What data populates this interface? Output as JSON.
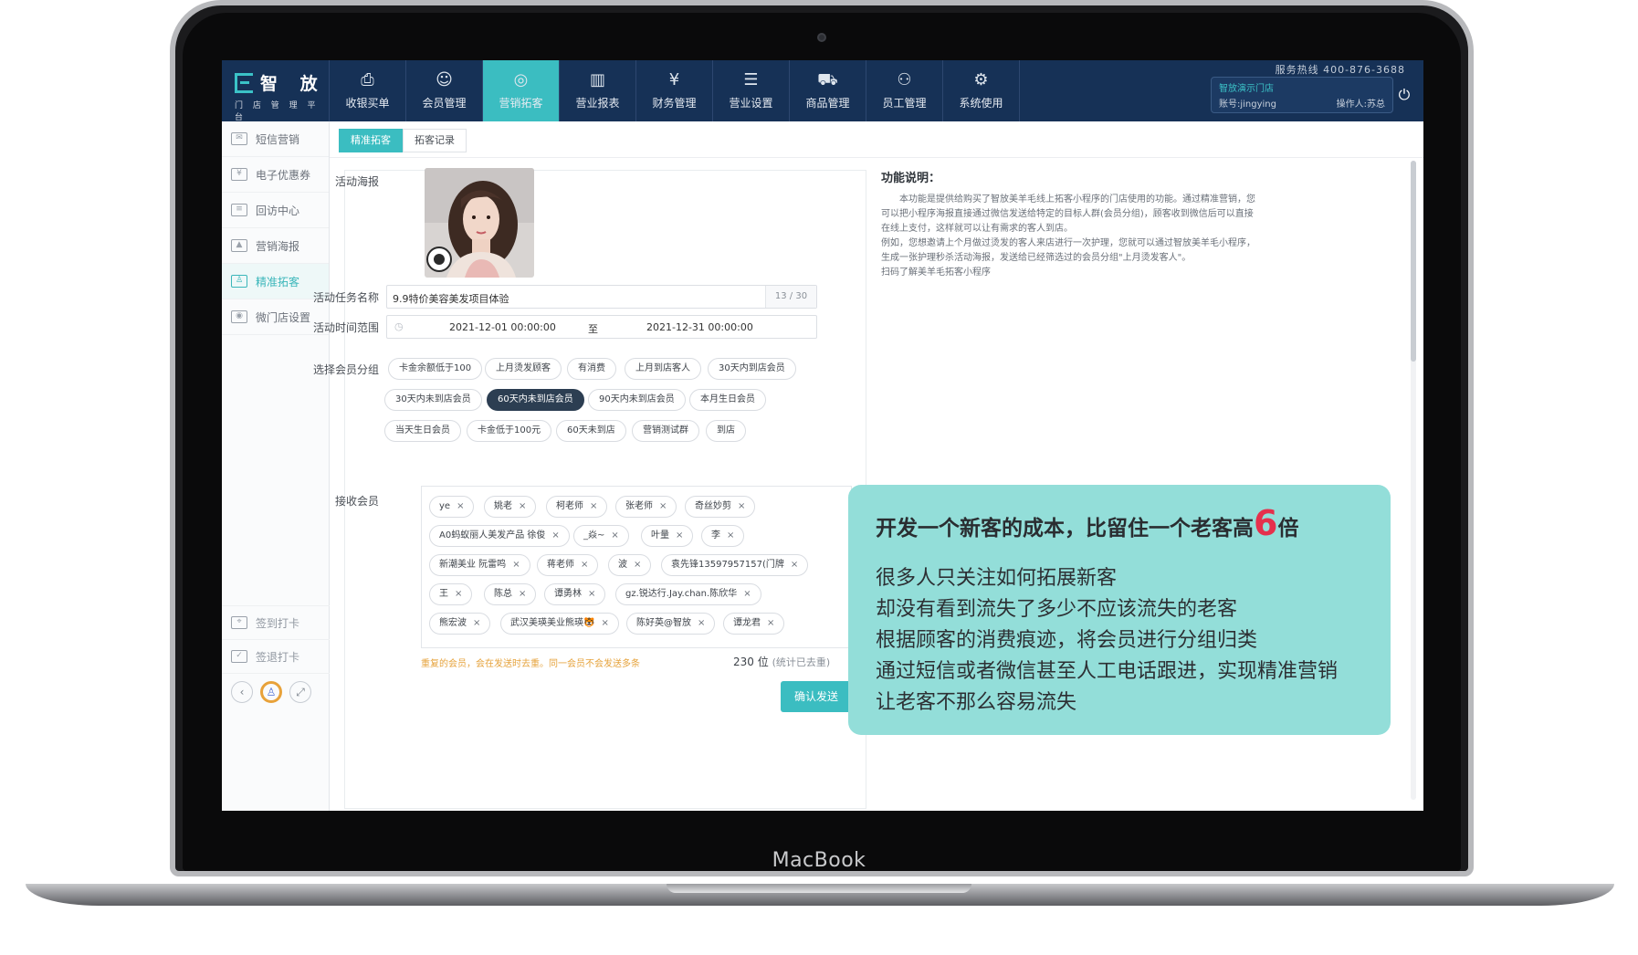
{
  "laptop_brand": "MacBook",
  "header": {
    "logo_name": "智 放",
    "logo_sub": "门 店 管 理 平 台",
    "hotline": "服务热线 400-876-3688",
    "store_name": "智放演示门店",
    "account": "账号:jingying",
    "operator": "操作人:苏总",
    "nav": [
      {
        "label": "收银买单",
        "icon": "cashier-icon"
      },
      {
        "label": "会员管理",
        "icon": "member-icon"
      },
      {
        "label": "营销拓客",
        "icon": "wechat-icon"
      },
      {
        "label": "营业报表",
        "icon": "chart-icon"
      },
      {
        "label": "财务管理",
        "icon": "moneybag-icon"
      },
      {
        "label": "营业设置",
        "icon": "list-icon"
      },
      {
        "label": "商品管理",
        "icon": "cart-icon"
      },
      {
        "label": "员工管理",
        "icon": "org-icon"
      },
      {
        "label": "系统使用",
        "icon": "gear-icon"
      }
    ]
  },
  "sidebar": {
    "items": [
      {
        "label": "短信营销"
      },
      {
        "label": "电子优惠券"
      },
      {
        "label": "回访中心"
      },
      {
        "label": "营销海报"
      },
      {
        "label": "精准拓客"
      },
      {
        "label": "微门店设置"
      }
    ],
    "checkin": "签到打卡",
    "checkout": "签退打卡"
  },
  "tabs": [
    "精准拓客",
    "拓客记录"
  ],
  "form": {
    "poster_label": "活动海报",
    "task_label": "活动任务名称",
    "task_value": "9.9特价美容美发项目体验",
    "task_counter": "13 / 30",
    "time_label": "活动时间范围",
    "time_start": "2021-12-01 00:00:00",
    "time_to": "至",
    "time_end": "2021-12-31 00:00:00",
    "group_label": "选择会员分组",
    "groups": [
      "卡金余额低于100",
      "上月烫发顾客",
      "有消费",
      "上月到店客人",
      "30天内到店会员",
      "30天内未到店会员",
      "60天内未到店会员",
      "90天内未到店会员",
      "本月生日会员",
      "当天生日会员",
      "卡金低于100元",
      "60天未到店",
      "营销测试群",
      "到店"
    ],
    "selected_group": "60天内未到店会员",
    "receive_label": "接收会员",
    "members": [
      "ye",
      "姚老",
      "柯老师",
      "张老师",
      "奇丝妙剪",
      "A0蚂蚁丽人美发产品 徐俊",
      "_焱~",
      "叶量",
      "李",
      "新潮美业 阮雷鸣",
      "蒋老师",
      "波",
      "袁先锋13597957157(门牌",
      "王",
      "陈总",
      "谭勇林",
      "gz.锐达行.Jay.chan.陈欣华",
      "熊宏波",
      "武汉美瑛美业熊瑛🐯",
      "陈好英@智放",
      "谭龙君"
    ],
    "remove_glyph": "×",
    "hint": "重复的会员，会在发送时去重。同一会员不会发送多条",
    "count": "230 位",
    "count_note": "(统计已去重)",
    "confirm": "确认发送"
  },
  "description": {
    "title": "功能说明：",
    "p1": "本功能是提供给购买了智放美羊毛线上拓客小程序的门店使用的功能。通过精准营销，您可以把小程序海报直接通过微信发送给特定的目标人群(会员分组)，顾客收到微信后可以直接在线上支付，这样就可以让有需求的客人到店。",
    "p2": "例如，您想邀请上个月做过烫发的客人来店进行一次护理，您就可以通过智放美羊毛小程序，生成一张护理秒杀活动海报，发送给已经筛选过的会员分组\"上月烫发客人\"。",
    "p3": "扫码了解美羊毛拓客小程序"
  },
  "callout": {
    "title_pre": "开发一个新客的成本，比留住一个老客高",
    "title_num": "6",
    "title_post": "倍",
    "lines": [
      "很多人只关注如何拓展新客",
      "却没有看到流失了多少不应该流失的老客",
      "根据顾客的消费痕迹，将会员进行分组归类",
      "通过短信或者微信甚至人工电话跟进，实现精准营销",
      "让老客不那么容易流失"
    ]
  },
  "colors": {
    "topbar": "#163156",
    "accent": "#3bbdc1",
    "callout": "#93ded9",
    "highlight": "#e5304c"
  }
}
